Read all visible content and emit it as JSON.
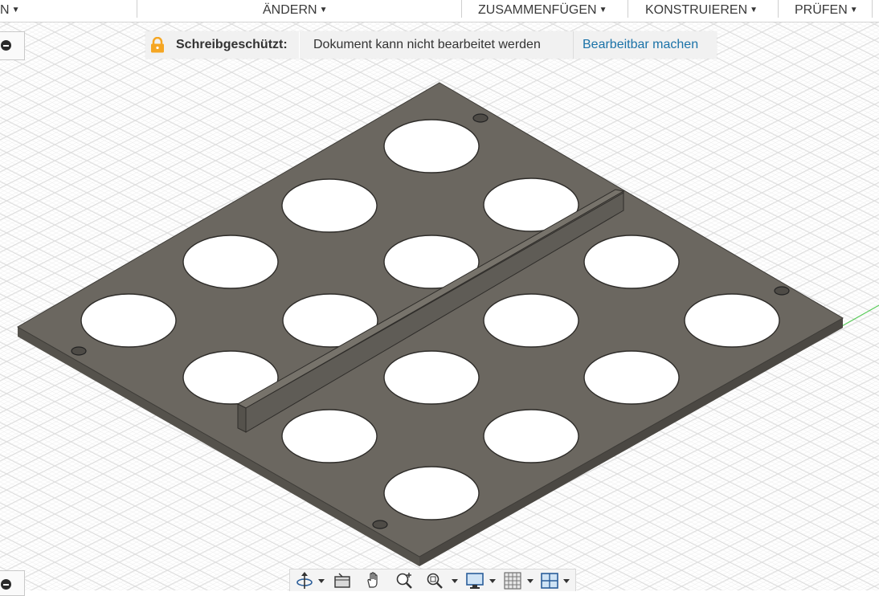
{
  "toolbar": {
    "items": [
      {
        "label": "N"
      },
      {
        "label": "ÄNDERN"
      },
      {
        "label": "ZUSAMMENFÜGEN"
      },
      {
        "label": "KONSTRUIEREN"
      },
      {
        "label": "PRÜFEN"
      }
    ]
  },
  "banner": {
    "title": "Schreibgeschützt:",
    "message": "Dokument kann nicht bearbeitet werden",
    "action": "Bearbeitbar machen",
    "icon": "lock-icon",
    "icon_color": "#f5a623",
    "link_color": "#1a72a8"
  },
  "model": {
    "body_color": "#6b6760",
    "hole_count": 16,
    "pin_hole_count": 4
  },
  "navbar": {
    "icons": [
      "orbit-icon",
      "look-at-icon",
      "pan-icon",
      "zoom-icon",
      "fit-icon",
      "display-settings-icon",
      "grid-icon",
      "viewports-icon"
    ]
  },
  "colors": {
    "grid": "#dcdcdc",
    "x_axis": "#e06060",
    "y_axis": "#5ccc5c"
  }
}
